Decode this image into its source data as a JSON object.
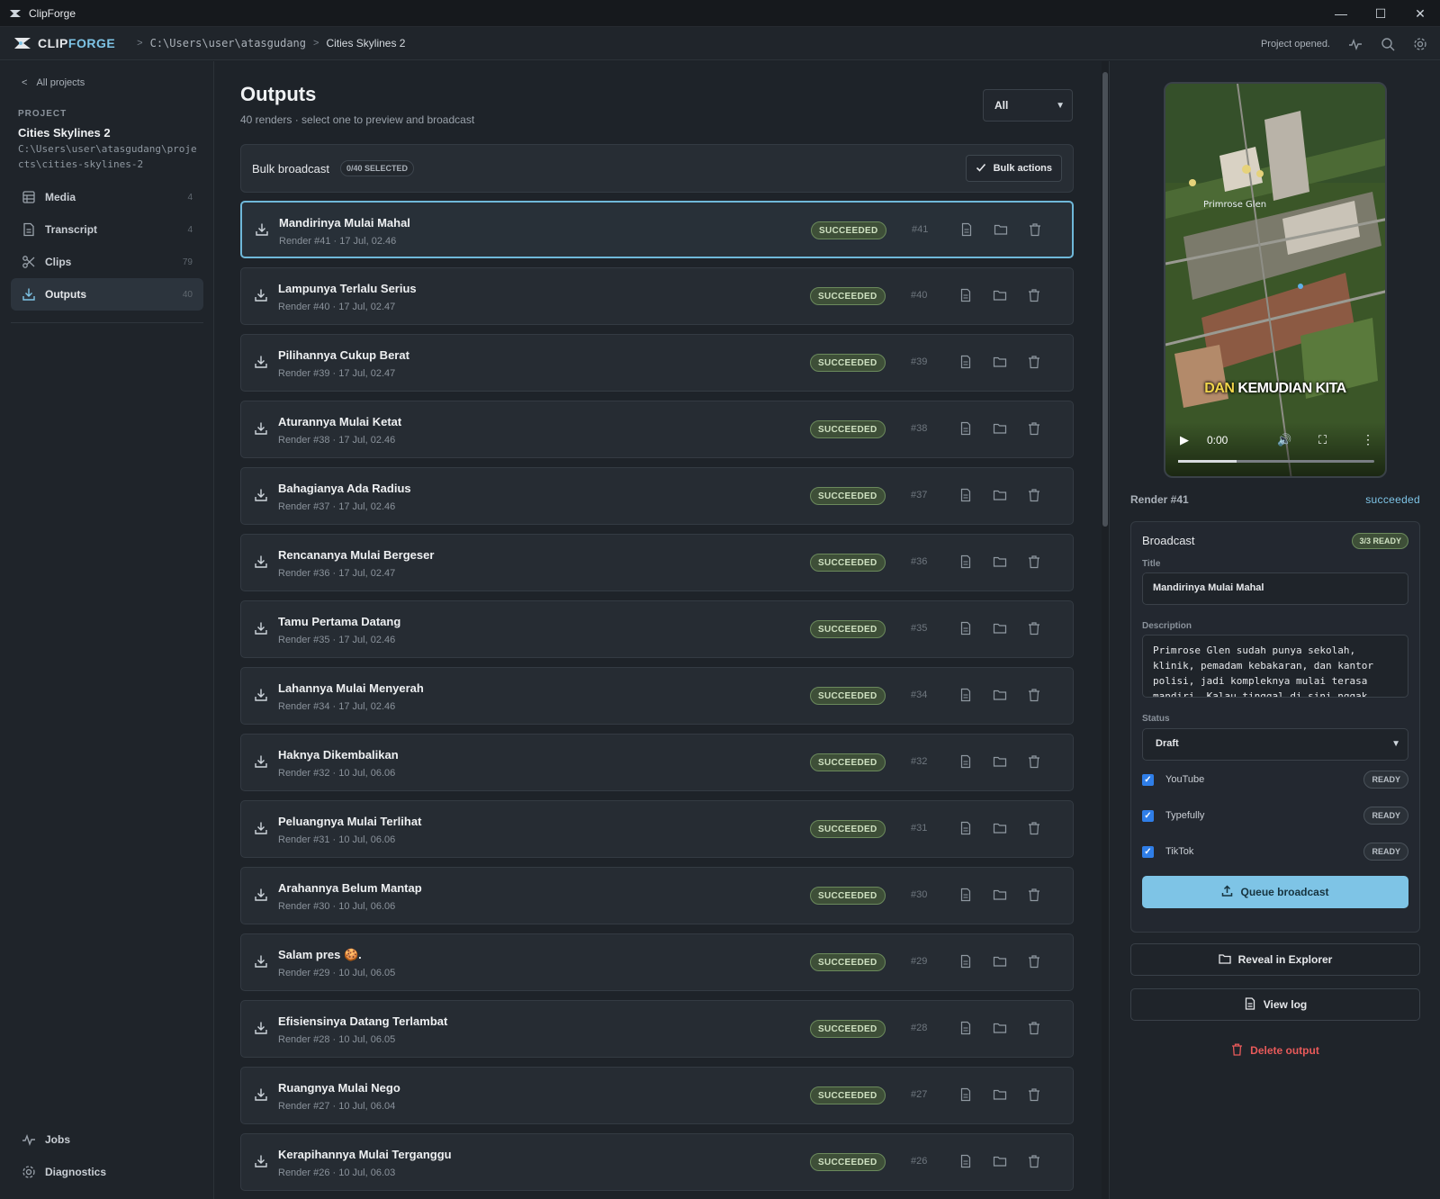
{
  "window": {
    "title": "ClipForge",
    "controls": [
      "—",
      "☐",
      "✕"
    ]
  },
  "header": {
    "brand_a": "CLIP",
    "brand_b": "FORGE",
    "breadcrumb_path": "C:\\Users\\user\\atasgudang",
    "breadcrumb_current": "Cities Skylines 2",
    "status": "Project opened."
  },
  "sidebar": {
    "back_label": "All projects",
    "project_label": "PROJECT",
    "project_name": "Cities Skylines 2",
    "project_path": "C:\\Users\\user\\atasgudang\\projects\\cities-skylines-2",
    "items": [
      {
        "label": "Media",
        "count": "4",
        "icon": "grid-icon"
      },
      {
        "label": "Transcript",
        "count": "4",
        "icon": "document-icon"
      },
      {
        "label": "Clips",
        "count": "79",
        "icon": "scissors-icon"
      },
      {
        "label": "Outputs",
        "count": "40",
        "icon": "download-icon",
        "active": true
      }
    ],
    "bottom": [
      {
        "label": "Jobs",
        "icon": "activity-icon"
      },
      {
        "label": "Diagnostics",
        "icon": "gear-icon"
      }
    ]
  },
  "main": {
    "title": "Outputs",
    "subtitle": "40 renders · select one to preview and broadcast",
    "filter_value": "All",
    "bulk": {
      "title": "Bulk broadcast",
      "selected": "0/40 SELECTED",
      "button": "Bulk actions"
    },
    "rows": [
      {
        "title": "Mandirinya Mulai Mahal",
        "sub": "Render #41 · 17 Jul, 02.46",
        "status": "SUCCEEDED",
        "num": "#41",
        "selected": true
      },
      {
        "title": "Lampunya Terlalu Serius",
        "sub": "Render #40 · 17 Jul, 02.47",
        "status": "SUCCEEDED",
        "num": "#40"
      },
      {
        "title": "Pilihannya Cukup Berat",
        "sub": "Render #39 · 17 Jul, 02.47",
        "status": "SUCCEEDED",
        "num": "#39"
      },
      {
        "title": "Aturannya Mulai Ketat",
        "sub": "Render #38 · 17 Jul, 02.46",
        "status": "SUCCEEDED",
        "num": "#38"
      },
      {
        "title": "Bahagianya Ada Radius",
        "sub": "Render #37 · 17 Jul, 02.46",
        "status": "SUCCEEDED",
        "num": "#37"
      },
      {
        "title": "Rencananya Mulai Bergeser",
        "sub": "Render #36 · 17 Jul, 02.47",
        "status": "SUCCEEDED",
        "num": "#36"
      },
      {
        "title": "Tamu Pertama Datang",
        "sub": "Render #35 · 17 Jul, 02.46",
        "status": "SUCCEEDED",
        "num": "#35"
      },
      {
        "title": "Lahannya Mulai Menyerah",
        "sub": "Render #34 · 17 Jul, 02.46",
        "status": "SUCCEEDED",
        "num": "#34"
      },
      {
        "title": "Haknya Dikembalikan",
        "sub": "Render #32 · 10 Jul, 06.06",
        "status": "SUCCEEDED",
        "num": "#32"
      },
      {
        "title": "Peluangnya Mulai Terlihat",
        "sub": "Render #31 · 10 Jul, 06.06",
        "status": "SUCCEEDED",
        "num": "#31"
      },
      {
        "title": "Arahannya Belum Mantap",
        "sub": "Render #30 · 10 Jul, 06.06",
        "status": "SUCCEEDED",
        "num": "#30"
      },
      {
        "title": "Salam pres 🍪.",
        "sub": "Render #29 · 10 Jul, 06.05",
        "status": "SUCCEEDED",
        "num": "#29"
      },
      {
        "title": "Efisiensinya Datang Terlambat",
        "sub": "Render #28 · 10 Jul, 06.05",
        "status": "SUCCEEDED",
        "num": "#28"
      },
      {
        "title": "Ruangnya Mulai Nego",
        "sub": "Render #27 · 10 Jul, 06.04",
        "status": "SUCCEEDED",
        "num": "#27"
      },
      {
        "title": "Kerapihannya Mulai Terganggu",
        "sub": "Render #26 · 10 Jul, 06.03",
        "status": "SUCCEEDED",
        "num": "#26"
      }
    ]
  },
  "preview": {
    "map_label": "Primrose Glen",
    "caption_a": "DAN",
    "caption_b": "KEMUDIAN KITA",
    "time": "0:00",
    "progress": 0.3,
    "render_label": "Render #41",
    "render_status": "succeeded"
  },
  "broadcast": {
    "title": "Broadcast",
    "ready": "3/3 READY",
    "title_label": "Title",
    "title_value": "Mandirinya Mulai Mahal",
    "description_label": "Description",
    "description_value": "Primrose Glen sudah punya sekolah, klinik, pemadam kebakaran, dan kantor polisi, jadi kompleknya mulai terasa mandiri. Kalau tinggal di sini nggak",
    "status_label": "Status",
    "status_value": "Draft",
    "platforms": [
      {
        "name": "YouTube",
        "badge": "READY",
        "checked": true
      },
      {
        "name": "Typefully",
        "badge": "READY",
        "checked": true
      },
      {
        "name": "TikTok",
        "badge": "READY",
        "checked": true
      }
    ],
    "queue_button": "Queue broadcast"
  },
  "actions": {
    "reveal": "Reveal in Explorer",
    "view_log": "View log",
    "delete": "Delete output"
  },
  "colors": {
    "accent": "#7ec4e6",
    "success_bg": "#3e4f38",
    "danger": "#e85a5a"
  }
}
